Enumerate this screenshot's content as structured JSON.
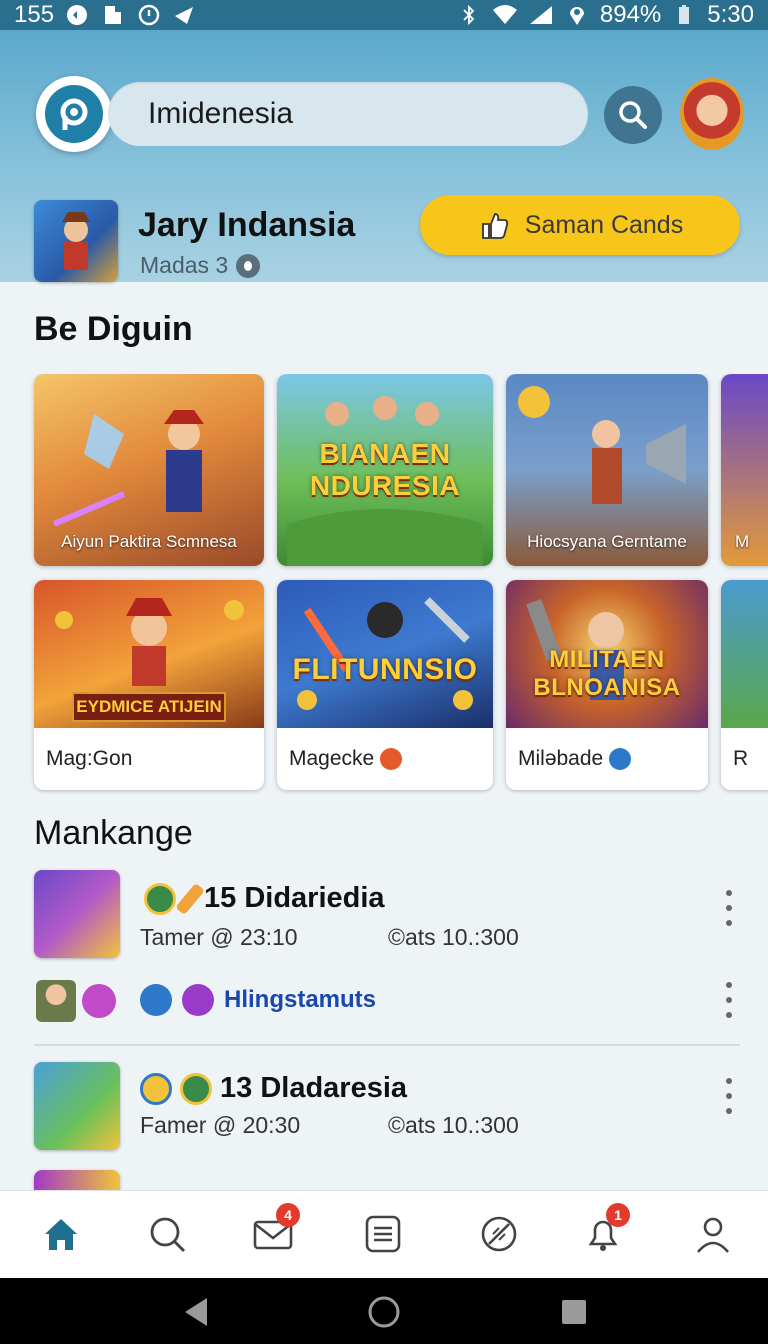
{
  "status_bar": {
    "left_text": "155",
    "battery": "894%",
    "time": "5:30"
  },
  "search": {
    "value": "Imidenesia"
  },
  "profile": {
    "name": "Jary Indansia",
    "subtitle": "Madas 3",
    "cta_label": "Saman Cands"
  },
  "featured": {
    "title": "Be Diguin",
    "cards": [
      {
        "caption": "Aiyun Paktira Scmnesa"
      },
      {
        "big_title": "BIANAEN NDURESIA"
      },
      {
        "caption": "Hiocsyana Gerntame"
      },
      {
        "caption": "M"
      },
      {
        "banner": "EYDMICE ATIJEIN",
        "footer": "Mag:Gon"
      },
      {
        "big_title": "FLITUNNSIO",
        "footer": "Magecke"
      },
      {
        "big_title": "MILITAEN BLNOANISA",
        "footer": "Miləbade"
      },
      {
        "footer": "R"
      }
    ]
  },
  "ranking": {
    "title": "Mankange",
    "items": [
      {
        "title": "15 Didariedia",
        "meta_left": "Tamer @ 23:10",
        "meta_right": "©ats 10.:300",
        "sub_label": "Hlingstamuts"
      },
      {
        "title": "13 Dladaresia",
        "meta_left": "Famer @ 20:30",
        "meta_right": "©ats 10.:300"
      }
    ]
  },
  "bottom_nav": {
    "mail_badge": "4",
    "bell_badge": "1"
  },
  "colors": {
    "accent": "#1f7fa6",
    "cta": "#f8c51a",
    "header_top": "#5aa9cc",
    "link": "#1a46b0"
  }
}
